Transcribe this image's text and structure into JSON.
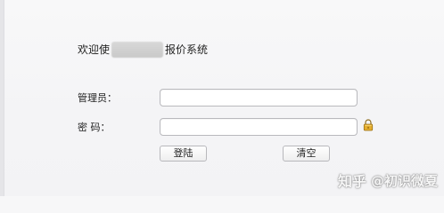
{
  "header": {
    "title_prefix": "欢迎使",
    "title_suffix": "报价系统"
  },
  "form": {
    "admin_label": "管理员：",
    "admin_value": "",
    "admin_placeholder": "",
    "password_label": "密 码：",
    "password_value": "",
    "password_placeholder": "",
    "lock_icon": "lock-icon"
  },
  "buttons": {
    "login_label": "登陆",
    "clear_label": "清空"
  },
  "watermark": {
    "brand": "知乎",
    "handle": "@初识微夏"
  },
  "colors": {
    "background": "#f7f7f8",
    "border": "#b9b9bd",
    "lock": "#d39a1f"
  }
}
